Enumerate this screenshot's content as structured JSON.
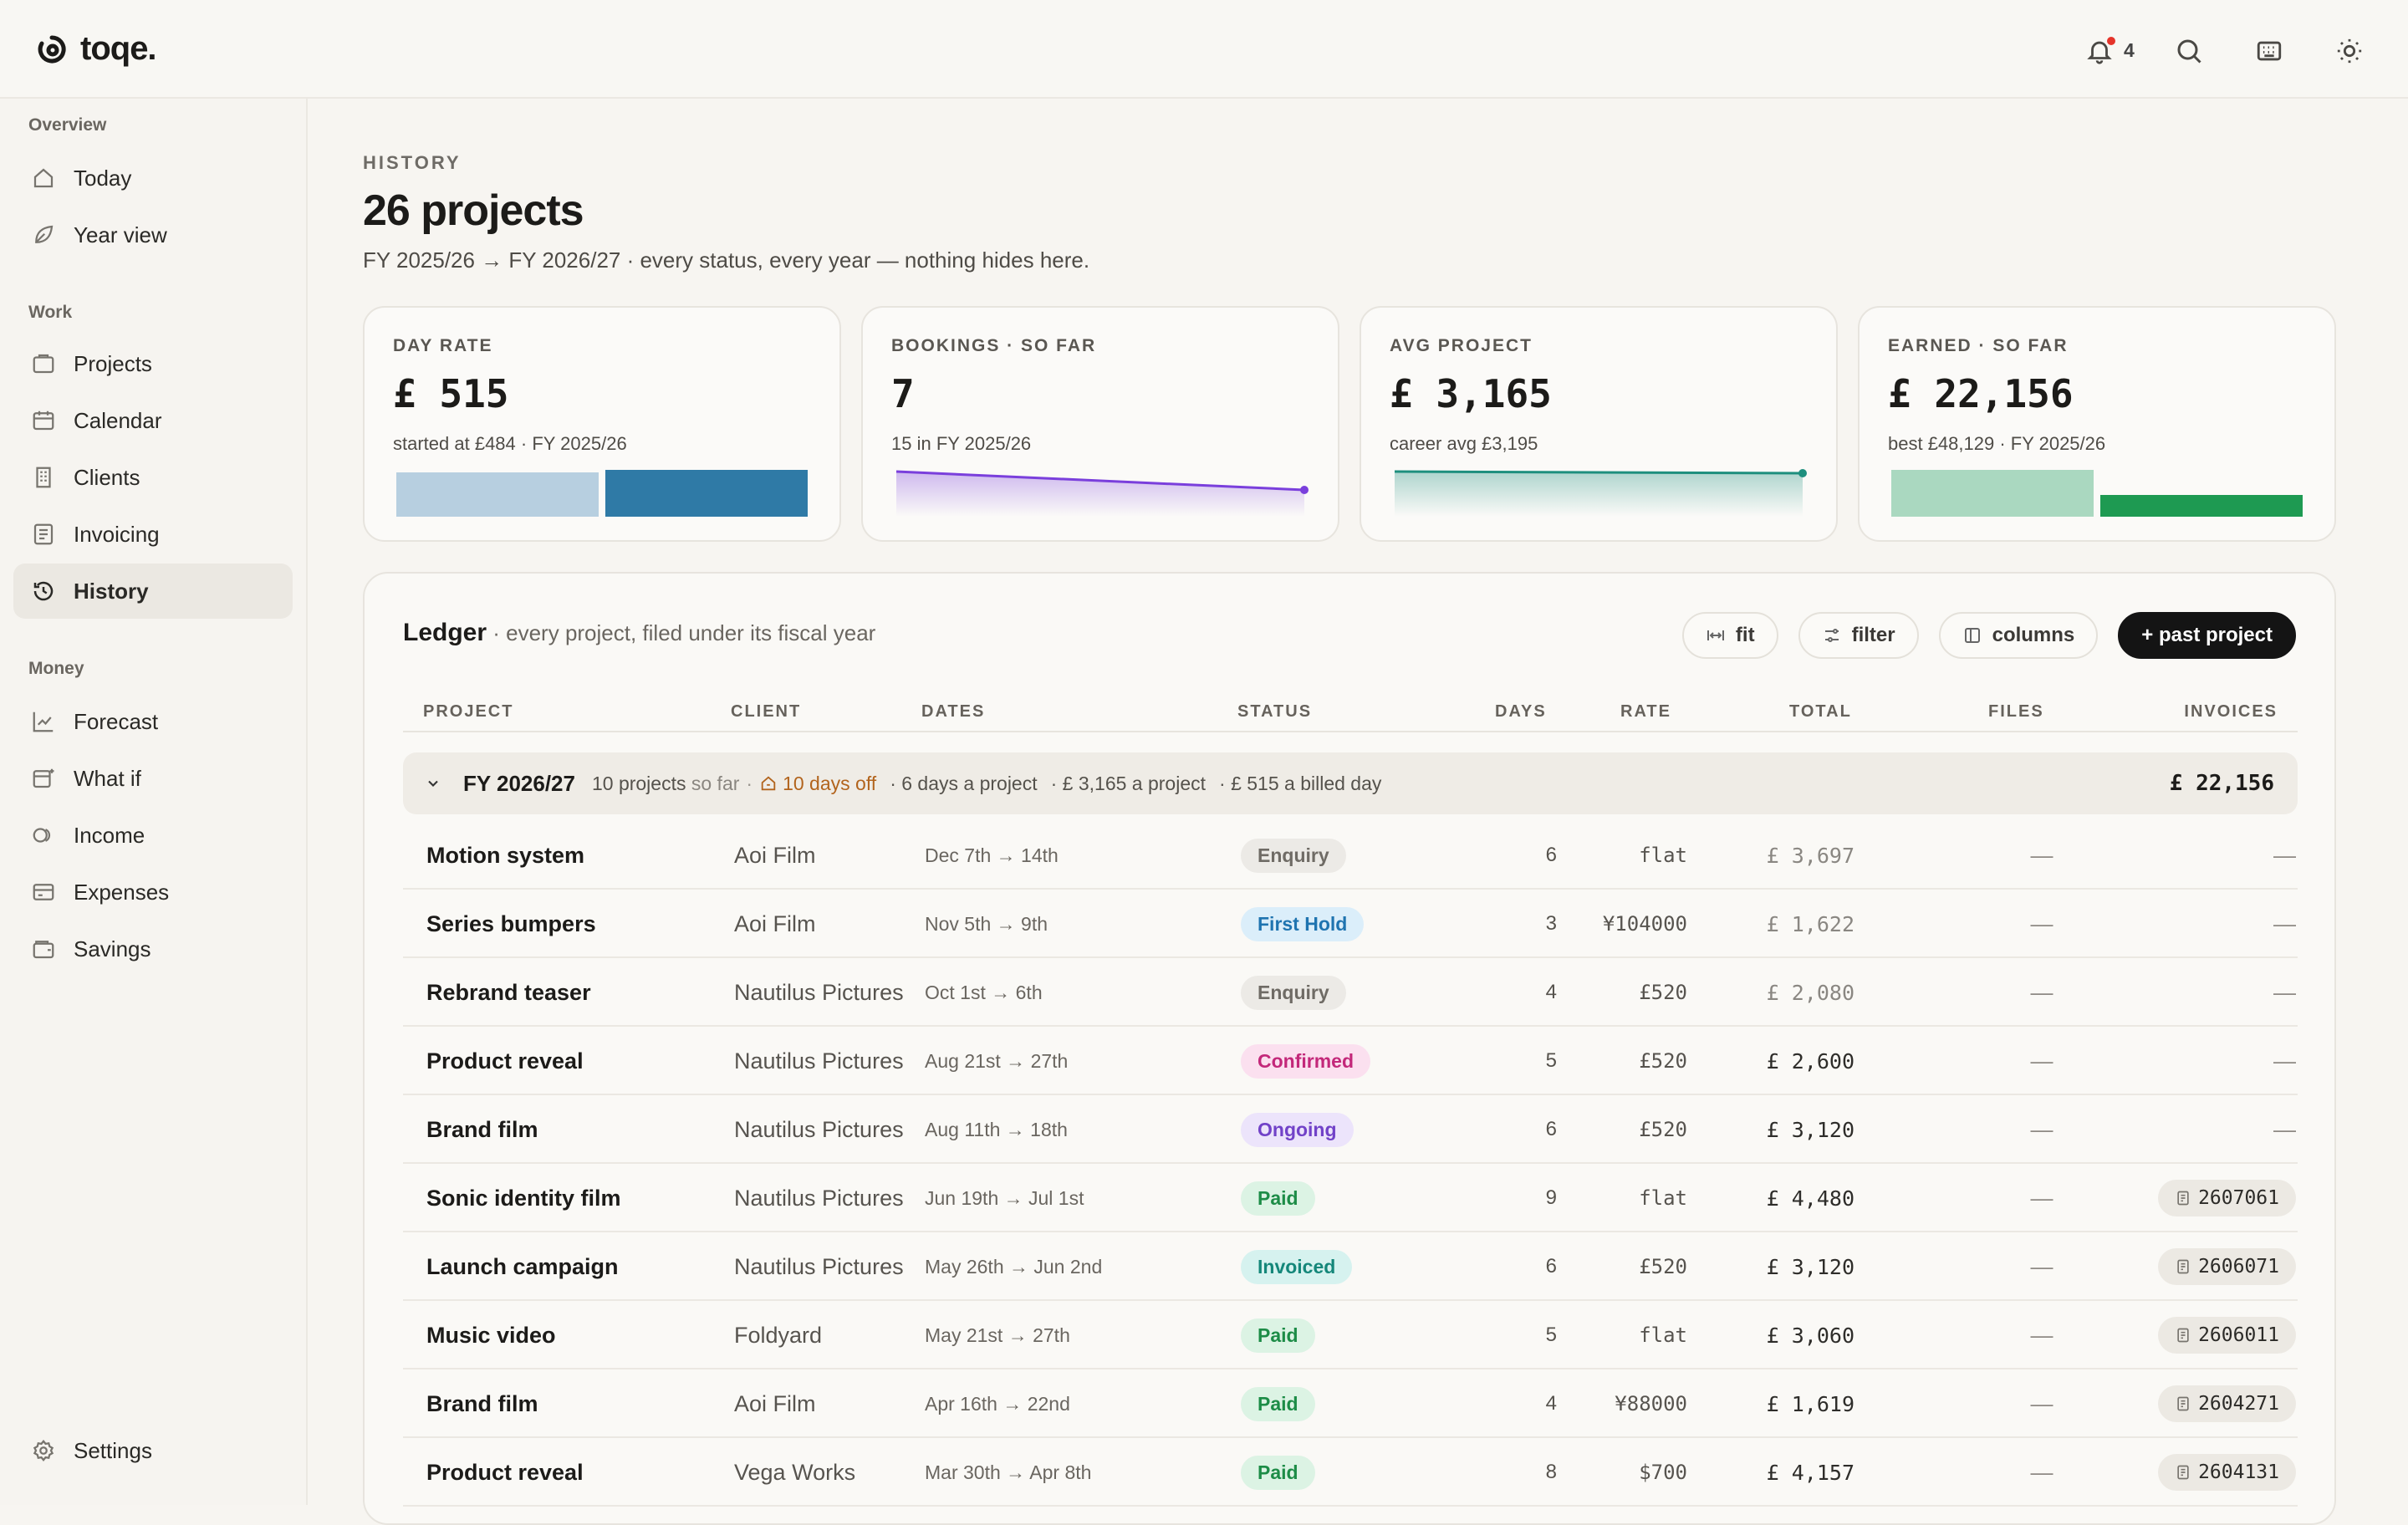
{
  "app": {
    "name": "toqe."
  },
  "topbar": {
    "notification_count": "4"
  },
  "sidebar": {
    "sections": [
      {
        "label": "Overview",
        "items": [
          {
            "label": "Today",
            "icon": "home-icon"
          },
          {
            "label": "Year view",
            "icon": "leaf-icon"
          }
        ]
      },
      {
        "label": "Work",
        "items": [
          {
            "label": "Projects",
            "icon": "folder-icon"
          },
          {
            "label": "Calendar",
            "icon": "calendar-icon"
          },
          {
            "label": "Clients",
            "icon": "building-icon"
          },
          {
            "label": "Invoicing",
            "icon": "invoice-icon"
          },
          {
            "label": "History",
            "icon": "history-icon",
            "active": true
          }
        ]
      },
      {
        "label": "Money",
        "items": [
          {
            "label": "Forecast",
            "icon": "chart-icon"
          },
          {
            "label": "What if",
            "icon": "sparkle-calendar-icon"
          },
          {
            "label": "Income",
            "icon": "coins-icon"
          },
          {
            "label": "Expenses",
            "icon": "card-icon"
          },
          {
            "label": "Savings",
            "icon": "wallet-icon"
          }
        ]
      }
    ],
    "settings_label": "Settings"
  },
  "header": {
    "eyebrow": "HISTORY",
    "title": "26 projects",
    "subtitle": "FY 2025/26 → FY 2026/27 · every status, every year — nothing hides here."
  },
  "stats": [
    {
      "label": "DAY RATE",
      "value": "£ 515",
      "note": "started at £484 · FY 2025/26",
      "viz": "bars",
      "bars": [
        {
          "value": 484,
          "color": "#b7cfe0"
        },
        {
          "value": 515,
          "color": "#2f7aa6"
        }
      ]
    },
    {
      "label": "BOOKINGS · SO FAR",
      "value": "7",
      "note": "15 in FY 2025/26",
      "viz": "line",
      "line": {
        "color": "#7a3fdc",
        "from": 15,
        "to": 7
      }
    },
    {
      "label": "AVG PROJECT",
      "value": "£ 3,165",
      "note": "career avg £3,195",
      "viz": "line",
      "line": {
        "color": "#1e8f7e",
        "from": 3195,
        "to": 3165
      }
    },
    {
      "label": "EARNED · SO FAR",
      "value": "£ 22,156",
      "note": "best £48,129 · FY 2025/26",
      "viz": "bars",
      "bars": [
        {
          "value": 48129,
          "color": "#aad8c0"
        },
        {
          "value": 22156,
          "color": "#1e9a52"
        }
      ]
    }
  ],
  "ledger": {
    "title": "Ledger",
    "subtitle": " · every project, filed under its fiscal year",
    "actions": {
      "fit": "fit",
      "filter": "filter",
      "columns": "columns",
      "add": "+ past project"
    },
    "columns": [
      "PROJECT",
      "CLIENT",
      "DATES",
      "STATUS",
      "DAYS",
      "RATE",
      "TOTAL",
      "FILES",
      "INVOICES"
    ],
    "group": {
      "fy": "FY 2026/27",
      "count": "10 projects",
      "count_suffix": "so far",
      "days_off": "10 days off",
      "days_per": "· 6 days a project",
      "avg": "· £ 3,165 a project",
      "billed_day": "· £ 515 a billed day",
      "total": "£ 22,156"
    },
    "rows": [
      {
        "project": "Motion system",
        "client": "Aoi Film",
        "dates": "Dec 7th → 14th",
        "status": "Enquiry",
        "days": "6",
        "rate": "flat",
        "total": "£ 3,697",
        "total_dim": true,
        "files": "—",
        "invoice": "—"
      },
      {
        "project": "Series bumpers",
        "client": "Aoi Film",
        "dates": "Nov 5th → 9th",
        "status": "First Hold",
        "days": "3",
        "rate": "¥104000",
        "total": "£ 1,622",
        "total_dim": true,
        "files": "—",
        "invoice": "—"
      },
      {
        "project": "Rebrand teaser",
        "client": "Nautilus Pictures",
        "dates": "Oct 1st → 6th",
        "status": "Enquiry",
        "days": "4",
        "rate": "£520",
        "total": "£ 2,080",
        "total_dim": true,
        "files": "—",
        "invoice": "—"
      },
      {
        "project": "Product reveal",
        "client": "Nautilus Pictures",
        "dates": "Aug 21st → 27th",
        "status": "Confirmed",
        "days": "5",
        "rate": "£520",
        "total": "£ 2,600",
        "total_dim": false,
        "files": "—",
        "invoice": "—"
      },
      {
        "project": "Brand film",
        "client": "Nautilus Pictures",
        "dates": "Aug 11th → 18th",
        "status": "Ongoing",
        "days": "6",
        "rate": "£520",
        "total": "£ 3,120",
        "total_dim": false,
        "files": "—",
        "invoice": "—"
      },
      {
        "project": "Sonic identity film",
        "client": "Nautilus Pictures",
        "dates": "Jun 19th → Jul 1st",
        "status": "Paid",
        "days": "9",
        "rate": "flat",
        "total": "£ 4,480",
        "total_dim": false,
        "files": "—",
        "invoice": "2607061"
      },
      {
        "project": "Launch campaign",
        "client": "Nautilus Pictures",
        "dates": "May 26th → Jun 2nd",
        "status": "Invoiced",
        "days": "6",
        "rate": "£520",
        "total": "£ 3,120",
        "total_dim": false,
        "files": "—",
        "invoice": "2606071"
      },
      {
        "project": "Music video",
        "client": "Foldyard",
        "dates": "May 21st → 27th",
        "status": "Paid",
        "days": "5",
        "rate": "flat",
        "total": "£ 3,060",
        "total_dim": false,
        "files": "—",
        "invoice": "2606011"
      },
      {
        "project": "Brand film",
        "client": "Aoi Film",
        "dates": "Apr 16th → 22nd",
        "status": "Paid",
        "days": "4",
        "rate": "¥88000",
        "total": "£ 1,619",
        "total_dim": false,
        "files": "—",
        "invoice": "2604271"
      },
      {
        "project": "Product reveal",
        "client": "Vega Works",
        "dates": "Mar 30th → Apr 8th",
        "status": "Paid",
        "days": "8",
        "rate": "$700",
        "total": "£ 4,157",
        "total_dim": false,
        "files": "—",
        "invoice": "2604131"
      }
    ]
  },
  "status_colors": {
    "Enquiry": {
      "bg": "#eceae6",
      "fg": "#6f6b65"
    },
    "First Hold": {
      "bg": "#dbeefa",
      "fg": "#1f74b0"
    },
    "Confirmed": {
      "bg": "#fbe0ef",
      "fg": "#c3287a"
    },
    "Ongoing": {
      "bg": "#ece4fb",
      "fg": "#7142c8"
    },
    "Paid": {
      "bg": "#dcf3e4",
      "fg": "#1d8c47"
    },
    "Invoiced": {
      "bg": "#d6f2ef",
      "fg": "#15877a"
    }
  }
}
